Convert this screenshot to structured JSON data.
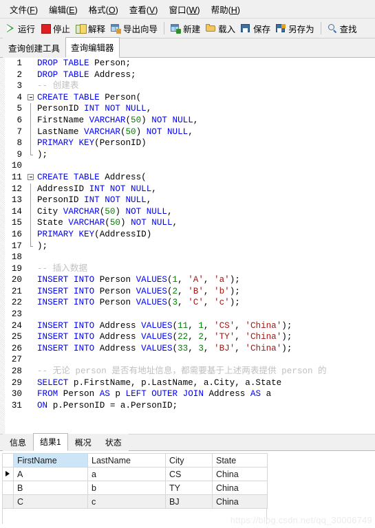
{
  "menubar": {
    "items": [
      {
        "label": "文件",
        "mnemonic": "F"
      },
      {
        "label": "编辑",
        "mnemonic": "E"
      },
      {
        "label": "格式",
        "mnemonic": "O"
      },
      {
        "label": "查看",
        "mnemonic": "V"
      },
      {
        "label": "窗口",
        "mnemonic": "W"
      },
      {
        "label": "帮助",
        "mnemonic": "H"
      }
    ]
  },
  "toolbar": {
    "buttons": [
      {
        "label": "运行",
        "icon": "run-triangle-icon"
      },
      {
        "label": "停止",
        "icon": "stop-square-icon"
      },
      {
        "label": "解释",
        "icon": "explain-note-icon"
      },
      {
        "label": "导出向导",
        "icon": "export-wizard-icon"
      },
      {
        "label": "新建",
        "icon": "new-query-icon"
      },
      {
        "label": "载入",
        "icon": "folder-open-icon"
      },
      {
        "label": "保存",
        "icon": "floppy-save-icon"
      },
      {
        "label": "另存为",
        "icon": "floppy-save-as-icon"
      },
      {
        "label": "查找",
        "icon": "search-magnifier-icon"
      }
    ]
  },
  "tabs": [
    {
      "label": "查询创建工具",
      "active": false
    },
    {
      "label": "查询编辑器",
      "active": true
    }
  ],
  "editor": {
    "lines": [
      {
        "n": "1",
        "fold": "none",
        "tokens": [
          {
            "t": "DROP TABLE ",
            "c": "kw"
          },
          {
            "t": "Person;",
            "c": "id"
          }
        ]
      },
      {
        "n": "2",
        "fold": "none",
        "tokens": [
          {
            "t": "DROP TABLE ",
            "c": "kw"
          },
          {
            "t": "Address;",
            "c": "id"
          }
        ]
      },
      {
        "n": "3",
        "fold": "none",
        "tokens": [
          {
            "t": "-- 创建表",
            "c": "cmt"
          }
        ]
      },
      {
        "n": "4",
        "fold": "start",
        "tokens": [
          {
            "t": "CREATE TABLE ",
            "c": "kw"
          },
          {
            "t": "Person(",
            "c": "id"
          }
        ]
      },
      {
        "n": "5",
        "fold": "mid",
        "tokens": [
          {
            "t": "PersonID ",
            "c": "id"
          },
          {
            "t": "INT NOT NULL",
            "c": "kw"
          },
          {
            "t": ",",
            "c": "pun"
          }
        ]
      },
      {
        "n": "6",
        "fold": "mid",
        "tokens": [
          {
            "t": "FirstName ",
            "c": "id"
          },
          {
            "t": "VARCHAR",
            "c": "kw"
          },
          {
            "t": "(",
            "c": "pun"
          },
          {
            "t": "50",
            "c": "num"
          },
          {
            "t": ") ",
            "c": "pun"
          },
          {
            "t": "NOT NULL",
            "c": "kw"
          },
          {
            "t": ",",
            "c": "pun"
          }
        ]
      },
      {
        "n": "7",
        "fold": "mid",
        "tokens": [
          {
            "t": "LastName ",
            "c": "id"
          },
          {
            "t": "VARCHAR",
            "c": "kw"
          },
          {
            "t": "(",
            "c": "pun"
          },
          {
            "t": "50",
            "c": "num"
          },
          {
            "t": ") ",
            "c": "pun"
          },
          {
            "t": "NOT NULL",
            "c": "kw"
          },
          {
            "t": ",",
            "c": "pun"
          }
        ]
      },
      {
        "n": "8",
        "fold": "mid",
        "tokens": [
          {
            "t": "PRIMARY KEY",
            "c": "kw"
          },
          {
            "t": "(PersonID)",
            "c": "id"
          }
        ]
      },
      {
        "n": "9",
        "fold": "end",
        "tokens": [
          {
            "t": ");",
            "c": "pun"
          }
        ]
      },
      {
        "n": "10",
        "fold": "none",
        "tokens": []
      },
      {
        "n": "11",
        "fold": "start",
        "tokens": [
          {
            "t": "CREATE TABLE ",
            "c": "kw"
          },
          {
            "t": "Address(",
            "c": "id"
          }
        ]
      },
      {
        "n": "12",
        "fold": "mid",
        "tokens": [
          {
            "t": "AddressID ",
            "c": "id"
          },
          {
            "t": "INT NOT NULL",
            "c": "kw"
          },
          {
            "t": ",",
            "c": "pun"
          }
        ]
      },
      {
        "n": "13",
        "fold": "mid",
        "tokens": [
          {
            "t": "PersonID ",
            "c": "id"
          },
          {
            "t": "INT NOT NULL",
            "c": "kw"
          },
          {
            "t": ",",
            "c": "pun"
          }
        ]
      },
      {
        "n": "14",
        "fold": "mid",
        "tokens": [
          {
            "t": "City ",
            "c": "id"
          },
          {
            "t": "VARCHAR",
            "c": "kw"
          },
          {
            "t": "(",
            "c": "pun"
          },
          {
            "t": "50",
            "c": "num"
          },
          {
            "t": ") ",
            "c": "pun"
          },
          {
            "t": "NOT NULL",
            "c": "kw"
          },
          {
            "t": ",",
            "c": "pun"
          }
        ]
      },
      {
        "n": "15",
        "fold": "mid",
        "tokens": [
          {
            "t": "State ",
            "c": "id"
          },
          {
            "t": "VARCHAR",
            "c": "kw"
          },
          {
            "t": "(",
            "c": "pun"
          },
          {
            "t": "50",
            "c": "num"
          },
          {
            "t": ") ",
            "c": "pun"
          },
          {
            "t": "NOT NULL",
            "c": "kw"
          },
          {
            "t": ",",
            "c": "pun"
          }
        ]
      },
      {
        "n": "16",
        "fold": "mid",
        "tokens": [
          {
            "t": "PRIMARY KEY",
            "c": "kw"
          },
          {
            "t": "(AddressID)",
            "c": "id"
          }
        ]
      },
      {
        "n": "17",
        "fold": "end",
        "tokens": [
          {
            "t": ");",
            "c": "pun"
          }
        ]
      },
      {
        "n": "18",
        "fold": "none",
        "tokens": []
      },
      {
        "n": "19",
        "fold": "none",
        "tokens": [
          {
            "t": "-- 插入数据",
            "c": "cmt"
          }
        ]
      },
      {
        "n": "20",
        "fold": "none",
        "tokens": [
          {
            "t": "INSERT INTO ",
            "c": "kw"
          },
          {
            "t": "Person ",
            "c": "id"
          },
          {
            "t": "VALUES",
            "c": "kw"
          },
          {
            "t": "(",
            "c": "pun"
          },
          {
            "t": "1",
            "c": "num"
          },
          {
            "t": ", ",
            "c": "pun"
          },
          {
            "t": "'A'",
            "c": "str"
          },
          {
            "t": ", ",
            "c": "pun"
          },
          {
            "t": "'a'",
            "c": "str"
          },
          {
            "t": ");",
            "c": "pun"
          }
        ]
      },
      {
        "n": "21",
        "fold": "none",
        "tokens": [
          {
            "t": "INSERT INTO ",
            "c": "kw"
          },
          {
            "t": "Person ",
            "c": "id"
          },
          {
            "t": "VALUES",
            "c": "kw"
          },
          {
            "t": "(",
            "c": "pun"
          },
          {
            "t": "2",
            "c": "num"
          },
          {
            "t": ", ",
            "c": "pun"
          },
          {
            "t": "'B'",
            "c": "str"
          },
          {
            "t": ", ",
            "c": "pun"
          },
          {
            "t": "'b'",
            "c": "str"
          },
          {
            "t": ");",
            "c": "pun"
          }
        ]
      },
      {
        "n": "22",
        "fold": "none",
        "tokens": [
          {
            "t": "INSERT INTO ",
            "c": "kw"
          },
          {
            "t": "Person ",
            "c": "id"
          },
          {
            "t": "VALUES",
            "c": "kw"
          },
          {
            "t": "(",
            "c": "pun"
          },
          {
            "t": "3",
            "c": "num"
          },
          {
            "t": ", ",
            "c": "pun"
          },
          {
            "t": "'C'",
            "c": "str"
          },
          {
            "t": ", ",
            "c": "pun"
          },
          {
            "t": "'c'",
            "c": "str"
          },
          {
            "t": ");",
            "c": "pun"
          }
        ]
      },
      {
        "n": "23",
        "fold": "none",
        "tokens": []
      },
      {
        "n": "24",
        "fold": "none",
        "tokens": [
          {
            "t": "INSERT INTO ",
            "c": "kw"
          },
          {
            "t": "Address ",
            "c": "id"
          },
          {
            "t": "VALUES",
            "c": "kw"
          },
          {
            "t": "(",
            "c": "pun"
          },
          {
            "t": "11",
            "c": "num"
          },
          {
            "t": ", ",
            "c": "pun"
          },
          {
            "t": "1",
            "c": "num"
          },
          {
            "t": ", ",
            "c": "pun"
          },
          {
            "t": "'CS'",
            "c": "str"
          },
          {
            "t": ", ",
            "c": "pun"
          },
          {
            "t": "'China'",
            "c": "str"
          },
          {
            "t": ");",
            "c": "pun"
          }
        ]
      },
      {
        "n": "25",
        "fold": "none",
        "tokens": [
          {
            "t": "INSERT INTO ",
            "c": "kw"
          },
          {
            "t": "Address ",
            "c": "id"
          },
          {
            "t": "VALUES",
            "c": "kw"
          },
          {
            "t": "(",
            "c": "pun"
          },
          {
            "t": "22",
            "c": "num"
          },
          {
            "t": ", ",
            "c": "pun"
          },
          {
            "t": "2",
            "c": "num"
          },
          {
            "t": ", ",
            "c": "pun"
          },
          {
            "t": "'TY'",
            "c": "str"
          },
          {
            "t": ", ",
            "c": "pun"
          },
          {
            "t": "'China'",
            "c": "str"
          },
          {
            "t": ");",
            "c": "pun"
          }
        ]
      },
      {
        "n": "26",
        "fold": "none",
        "tokens": [
          {
            "t": "INSERT INTO ",
            "c": "kw"
          },
          {
            "t": "Address ",
            "c": "id"
          },
          {
            "t": "VALUES",
            "c": "kw"
          },
          {
            "t": "(",
            "c": "pun"
          },
          {
            "t": "33",
            "c": "num"
          },
          {
            "t": ", ",
            "c": "pun"
          },
          {
            "t": "3",
            "c": "num"
          },
          {
            "t": ", ",
            "c": "pun"
          },
          {
            "t": "'BJ'",
            "c": "str"
          },
          {
            "t": ", ",
            "c": "pun"
          },
          {
            "t": "'China'",
            "c": "str"
          },
          {
            "t": ");",
            "c": "pun"
          }
        ]
      },
      {
        "n": "27",
        "fold": "none",
        "tokens": []
      },
      {
        "n": "28",
        "fold": "none",
        "tokens": [
          {
            "t": "-- 无论 person 是否有地址信息，都需要基于上述两表提供 person 的",
            "c": "cmt"
          }
        ]
      },
      {
        "n": "29",
        "fold": "none",
        "tokens": [
          {
            "t": "SELECT ",
            "c": "kw"
          },
          {
            "t": "p.FirstName, p.LastName, a.City, a.State",
            "c": "id"
          }
        ]
      },
      {
        "n": "30",
        "fold": "none",
        "tokens": [
          {
            "t": "FROM ",
            "c": "kw"
          },
          {
            "t": "Person ",
            "c": "id"
          },
          {
            "t": "AS ",
            "c": "kw"
          },
          {
            "t": "p ",
            "c": "id"
          },
          {
            "t": "LEFT OUTER JOIN ",
            "c": "kw"
          },
          {
            "t": "Address ",
            "c": "id"
          },
          {
            "t": "AS ",
            "c": "kw"
          },
          {
            "t": "a",
            "c": "id"
          }
        ]
      },
      {
        "n": "31",
        "fold": "none",
        "tokens": [
          {
            "t": "ON ",
            "c": "kw"
          },
          {
            "t": "p.PersonID = a.PersonID;",
            "c": "id"
          }
        ]
      }
    ]
  },
  "results": {
    "tabs": [
      {
        "label": "信息",
        "active": false
      },
      {
        "label": "结果1",
        "active": true
      },
      {
        "label": "概况",
        "active": false
      },
      {
        "label": "状态",
        "active": false
      }
    ],
    "columns": [
      "FirstName",
      "LastName",
      "City",
      "State"
    ],
    "selected_column": "FirstName",
    "rows": [
      {
        "cells": [
          "A",
          "a",
          "CS",
          "China"
        ],
        "current": true
      },
      {
        "cells": [
          "B",
          "b",
          "TY",
          "China"
        ],
        "current": false
      },
      {
        "cells": [
          "C",
          "c",
          "BJ",
          "China"
        ],
        "current": false
      }
    ]
  },
  "watermark": "https://blog.csdn.net/qq_30006749",
  "colors": {
    "keyword": "#0000ff",
    "number": "#008000",
    "string": "#a31515",
    "comment": "#c0c0c0",
    "header_selected": "#cde6f7",
    "chrome": "#f0f0f0"
  }
}
